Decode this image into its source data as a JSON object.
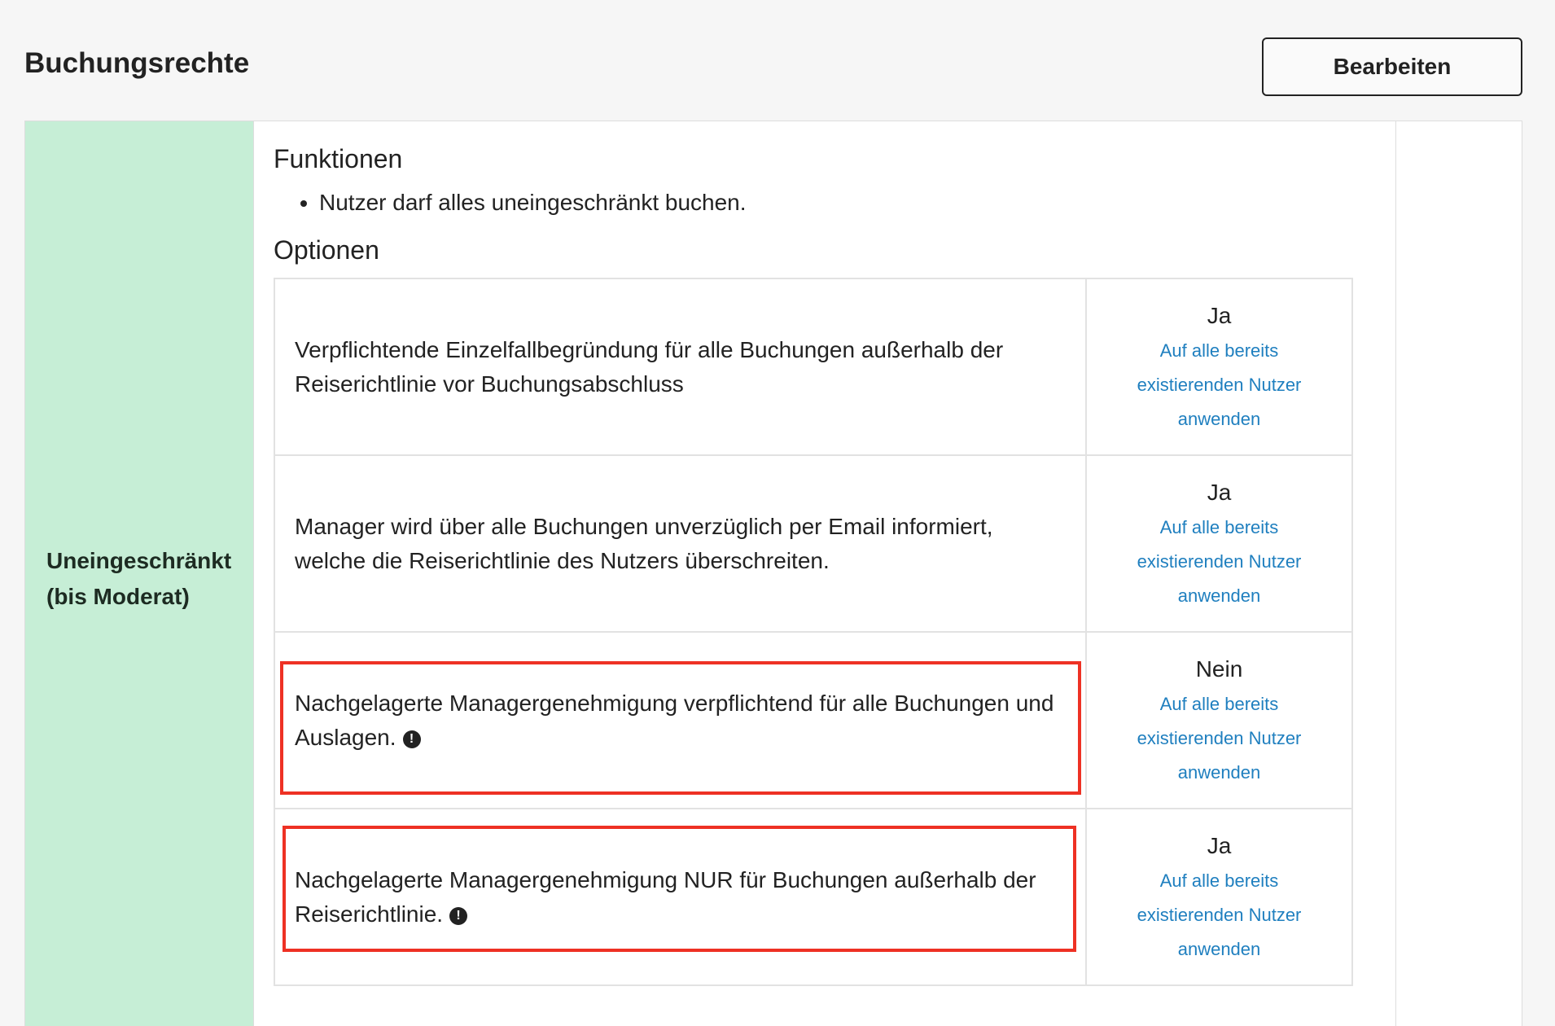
{
  "header": {
    "title": "Buchungsrechte",
    "edit_label": "Bearbeiten"
  },
  "level": {
    "label": "Uneingeschränkt (bis Moderat)",
    "color": "#c6eed6"
  },
  "functions": {
    "heading": "Funktionen",
    "items": [
      "Nutzer darf alles uneingeschränkt buchen."
    ]
  },
  "options": {
    "heading": "Optionen",
    "rows": [
      {
        "description": "Verpflichtende Einzelfallbegründung für alle Buchungen außerhalb der Reiserichtlinie vor Buchungsabschluss",
        "value": "Ja",
        "link": "Auf alle bereits existierenden Nutzer anwenden"
      },
      {
        "description": "Manager wird über alle Buchungen unverzüglich per Email informiert, welche die Reiserichtlinie des Nutzers überschreiten.",
        "value": "Ja",
        "link": "Auf alle bereits existierenden Nutzer anwenden"
      },
      {
        "description": "Nachgelagerte Managergenehmigung verpflichtend für alle Buchungen und Auslagen.",
        "value": "Nein",
        "link": "Auf alle bereits existierenden Nutzer anwenden",
        "icon": "exclamation-circle-icon"
      },
      {
        "description": "Nachgelagerte Managergenehmigung NUR für Buchungen außerhalb der Reiserichtlinie.",
        "value": "Ja",
        "link": "Auf alle bereits existierenden Nutzer anwenden",
        "icon": "exclamation-circle-icon"
      }
    ]
  },
  "colors": {
    "accent_link": "#1f7fbf",
    "highlight": "#ee3124"
  }
}
